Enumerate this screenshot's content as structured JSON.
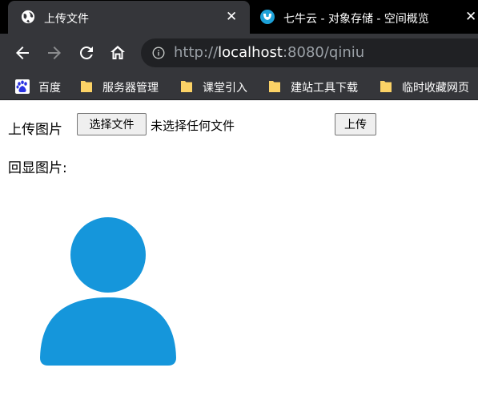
{
  "tabs": [
    {
      "title": "上传文件",
      "active": true,
      "icon": "globe-icon"
    },
    {
      "title": "七牛云 - 对象存储 - 空间概览",
      "active": false,
      "icon": "qiniu-icon"
    }
  ],
  "tab_close_glyph": "✕",
  "address_bar": {
    "scheme": "http://",
    "host": "localhost",
    "rest": ":8080/qiniu"
  },
  "bookmarks": [
    {
      "label": "百度",
      "icon": "baidu-icon"
    },
    {
      "label": "服务器管理",
      "icon": "folder-icon"
    },
    {
      "label": "课堂引入",
      "icon": "folder-icon"
    },
    {
      "label": "建站工具下载",
      "icon": "folder-icon"
    },
    {
      "label": "临时收藏网页",
      "icon": "folder-icon"
    }
  ],
  "form": {
    "upload_label": "上传图片",
    "file_button": "选择文件",
    "file_status": "未选择任何文件",
    "submit_button": "上传",
    "echo_label": "回显图片:"
  },
  "colors": {
    "accent": "#1596db",
    "tab_bg": "#35363a",
    "strip_bg": "#000000",
    "omnibox_bg": "#202124",
    "folder": "#fbd266"
  }
}
